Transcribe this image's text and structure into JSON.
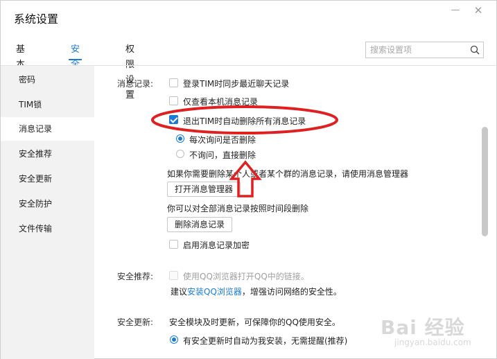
{
  "window": {
    "title": "系统设置",
    "minimize_icon": "minimize-icon",
    "close_icon": "close-icon"
  },
  "tabs": [
    {
      "label": "基本设置",
      "active": false
    },
    {
      "label": "安全设置",
      "active": true
    },
    {
      "label": "权限设置",
      "active": false
    }
  ],
  "search": {
    "placeholder": "搜索设置项",
    "icon": "search-icon"
  },
  "sidebar": {
    "items": [
      {
        "label": "密码",
        "active": false
      },
      {
        "label": "TIM锁",
        "active": false
      },
      {
        "label": "消息记录",
        "active": true
      },
      {
        "label": "安全推荐",
        "active": false
      },
      {
        "label": "安全更新",
        "active": false
      },
      {
        "label": "安全防护",
        "active": false
      },
      {
        "label": "文件传输",
        "active": false
      }
    ]
  },
  "message_records": {
    "label": "消息记录:",
    "sync_recent": {
      "label": "登录TIM时同步最近聊天记录",
      "checked": false
    },
    "view_local_only": {
      "label": "仅查看本机消息记录",
      "checked": false
    },
    "auto_delete_on_exit": {
      "label": "退出TIM时自动删除所有消息记录",
      "checked": true
    },
    "ask_each_time": {
      "label": "每次询问是否删除",
      "selected": true
    },
    "delete_directly": {
      "label": "不询问，直接删除",
      "selected": false
    },
    "manager_hint": "如果你需要删除某个人或者某个群的消息记录，请使用消息管理器",
    "open_manager_button": "打开消息管理器",
    "range_delete_hint": "你可以对全部消息记录按照时间段删除",
    "delete_records_button": "删除消息记录",
    "enable_encryption": {
      "label": "启用消息记录加密",
      "checked": false
    }
  },
  "security_recommend": {
    "label": "安全推荐:",
    "use_qq_browser": {
      "label": "使用QQ浏览器打开QQ中的链接。",
      "checked": false,
      "disabled": true
    },
    "suggest_prefix": "建议",
    "suggest_link": "安装QQ浏览器",
    "suggest_suffix": "，增强访问网络的安全性。"
  },
  "security_update": {
    "label": "安全更新:",
    "description": "安全模块及时更新，可保障你的QQ使用安全。",
    "auto_install": {
      "label": "有安全更新时自动为我安装，无需提醒(推荐)",
      "selected": true
    }
  },
  "annotation": {
    "color": "#e02020"
  },
  "colors": {
    "accent": "#1a7bd4",
    "sidebar_bg": "#f2f2f2"
  },
  "watermark": {
    "main": "Bai 经验",
    "sub": "jingyan.baidu.com"
  }
}
